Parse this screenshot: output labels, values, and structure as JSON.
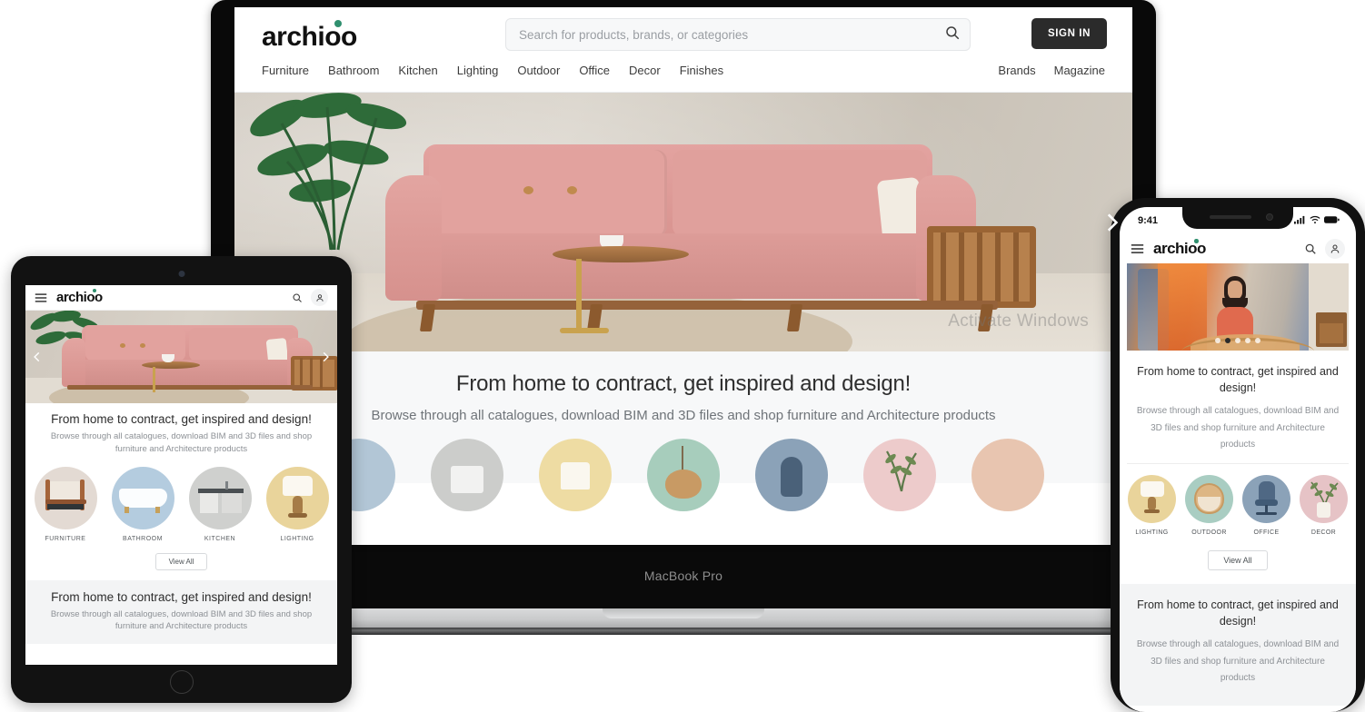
{
  "brand": {
    "name": "archioo",
    "dot_color": "#2f8f6e"
  },
  "laptop": {
    "device_label": "MacBook Pro",
    "watermark": "Activate Windows",
    "header": {
      "sign_in_label": "SIGN IN",
      "search_placeholder": "Search for products, brands, or categories",
      "search_value": ""
    },
    "nav": {
      "items": [
        "Furniture",
        "Bathroom",
        "Kitchen",
        "Lighting",
        "Outdoor",
        "Office",
        "Decor",
        "Finishes"
      ],
      "right_items": [
        "Brands",
        "Magazine"
      ]
    },
    "hero": {
      "next_label": "›"
    },
    "copy": {
      "heading": "From home to contract, get inspired and design!",
      "subheading": "Browse through all catalogues, download BIM and 3D files and shop furniture and Architecture products"
    },
    "categories": [
      {
        "label": "",
        "color": "#b2c6d6"
      },
      {
        "label": "",
        "color": "#cccdcb"
      },
      {
        "label": "",
        "color": "#eedca3"
      },
      {
        "label": "",
        "color": "#a7cdbc"
      },
      {
        "label": "",
        "color": "#8ba2b8"
      },
      {
        "label": "",
        "color": "#edcbcb"
      },
      {
        "label": "",
        "color": "#e8c5b0"
      }
    ]
  },
  "tablet": {
    "header": {
      "menu": "menu-icon",
      "search": "search-icon",
      "account": "user-icon"
    },
    "hero": {
      "prev_label": "‹",
      "next_label": "›"
    },
    "copy": {
      "heading": "From home to contract, get inspired and design!",
      "subheading": "Browse through all catalogues, download BIM and 3D files and shop furniture and Architecture products"
    },
    "categories": [
      {
        "label": "FURNITURE",
        "color": "#e3dad3"
      },
      {
        "label": "BATHROOM",
        "color": "#b4ccdf"
      },
      {
        "label": "KITCHEN",
        "color": "#cfd0ce"
      },
      {
        "label": "LIGHTING",
        "color": "#e9d49b"
      }
    ],
    "view_all_label": "View All",
    "footer": {
      "heading": "From home to contract, get inspired and design!",
      "subheading": "Browse through all catalogues, download BIM and 3D files and shop furniture and Architecture products"
    }
  },
  "phone": {
    "status": {
      "time": "9:41",
      "signal": "signal-icon",
      "wifi": "wifi-icon",
      "battery": "battery-icon"
    },
    "header": {
      "menu": "menu-icon",
      "search": "search-icon",
      "account": "user-icon"
    },
    "hero": {
      "dots": 5,
      "active_dot": 2
    },
    "copy": {
      "heading": "From home to contract, get inspired and design!",
      "subheading": "Browse through all catalogues, download BIM and 3D files and shop furniture and Architecture products"
    },
    "categories": [
      {
        "label": "LIGHTING",
        "color": "#e9d49b"
      },
      {
        "label": "OUTDOOR",
        "color": "#a9cdc2"
      },
      {
        "label": "OFFICE",
        "color": "#8ba2b8"
      },
      {
        "label": "DECOR",
        "color": "#e6c3c6"
      }
    ],
    "view_all_label": "View All",
    "footer": {
      "heading": "From home to contract, get inspired and design!",
      "subheading": "Browse through all catalogues, download BIM and 3D files and shop furniture and Architecture products"
    }
  }
}
